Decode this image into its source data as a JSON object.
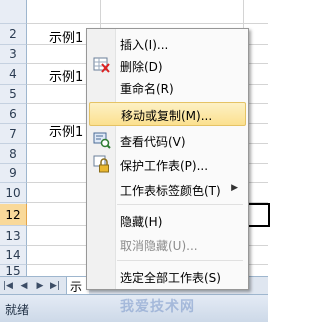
{
  "rows": [
    "",
    "2",
    "3",
    "4",
    "5",
    "6",
    "7",
    "8",
    "9",
    "10",
    "11",
    "12",
    "13",
    "14",
    "15"
  ],
  "selected_row": "12",
  "cells": [
    {
      "row": "2",
      "text": "示例1"
    },
    {
      "row": "4",
      "text": "示例1"
    },
    {
      "row": "7",
      "text": "示例1"
    },
    {
      "row": "15",
      "text": "示"
    }
  ],
  "context_menu": {
    "items": [
      {
        "label": "插入(I)...",
        "icon": "",
        "enabled": true
      },
      {
        "label": "删除(D)",
        "icon": "delete-sheet-icon",
        "enabled": true
      },
      {
        "label": "重命名(R)",
        "icon": "",
        "enabled": true
      },
      {
        "label": "移动或复制(M)...",
        "icon": "",
        "enabled": true,
        "highlighted": true
      },
      {
        "label": "查看代码(V)",
        "icon": "view-code-icon",
        "enabled": true
      },
      {
        "label": "保护工作表(P)...",
        "icon": "protect-sheet-icon",
        "enabled": true
      },
      {
        "label": "工作表标签颜色(T)",
        "icon": "",
        "enabled": true,
        "submenu": true
      },
      {
        "label": "隐藏(H)",
        "icon": "",
        "enabled": true
      },
      {
        "label": "取消隐藏(U)...",
        "icon": "",
        "enabled": false
      },
      {
        "label": "选定全部工作表(S)",
        "icon": "",
        "enabled": true
      }
    ]
  },
  "status": {
    "text": "就绪"
  },
  "watermark": "我爱技术网"
}
